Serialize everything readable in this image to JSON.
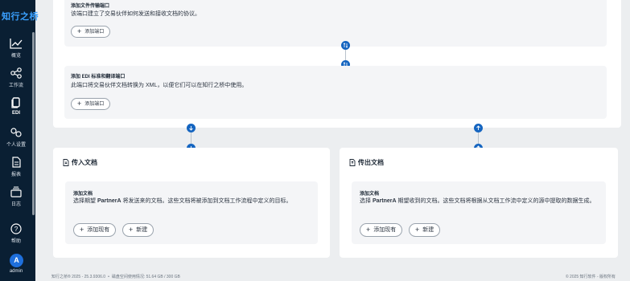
{
  "app": {
    "logo_text": "知行之桥"
  },
  "sidebar": {
    "items": [
      {
        "label": "概览",
        "icon": "chart-line-icon"
      },
      {
        "label": "工作流",
        "icon": "workflow-icon"
      },
      {
        "label": "EDI",
        "icon": "documents-icon"
      },
      {
        "label": "个人设置",
        "icon": "settings-icon"
      },
      {
        "label": "报表",
        "icon": "report-icon"
      },
      {
        "label": "日志",
        "icon": "logs-icon"
      },
      {
        "label": "帮助",
        "icon": "help-icon"
      }
    ],
    "user": {
      "avatar_letter": "A",
      "name": "admin"
    }
  },
  "top_panel": {
    "file_port": {
      "title": "添加文件传输端口",
      "description": "该端口建立了交易伙伴如何发送和接收文档的协议。",
      "button_label": "添加端口"
    },
    "edi_port": {
      "title": "添加 EDI 标准和翻译端口",
      "description": "此端口将交易伙伴文档转换为 XML，以便它们可以在知行之桥中使用。",
      "button_label": "添加端口"
    }
  },
  "inbound": {
    "title": "传入文档",
    "card_title": "添加文档",
    "description_prefix": "选择期望 ",
    "partner": "PartnerA",
    "description_suffix": " 将发送来的文档。这些文档将被添加到文档工作流程中定义的目标。",
    "add_existing_label": "添加现有",
    "new_label": "新建"
  },
  "outbound": {
    "title": "传出文档",
    "card_title": "添加文档",
    "description_prefix": "选择 ",
    "partner": "PartnerA",
    "description_suffix": " 期望收到的文档。这些文档将根据从文档工作流中定义的源中提取的数据生成。",
    "add_existing_label": "添加现有",
    "new_label": "新建"
  },
  "footer": {
    "product": "知行之桥® 2025 - 25.3.9306.0",
    "disk_label": "磁盘空间使用情况:",
    "disk_usage": "51.64 GB / 300 GB",
    "copyright": "© 2025 知行软件 - 版权所有"
  },
  "colors": {
    "sidebar_bg": "#0a1f33",
    "accent": "#1565c0",
    "logo": "#3aa0ff"
  }
}
